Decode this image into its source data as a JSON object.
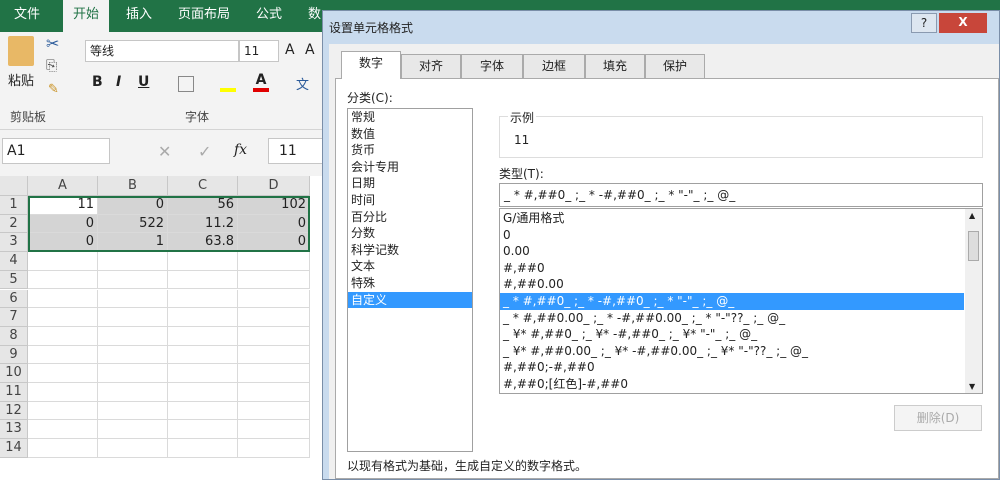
{
  "ribbon_tabs": [
    "文件",
    "开始",
    "插入",
    "页面布局",
    "公式",
    "数"
  ],
  "ribbon": {
    "paste": "粘贴",
    "clipboard_group": "剪贴板",
    "font_name": "等线",
    "font_size": "11",
    "font_group": "字体",
    "bold": "B",
    "italic": "I",
    "underline": "U",
    "phonetic": "文"
  },
  "formula_bar": {
    "name_box": "A1",
    "fx": "fx",
    "value": "11"
  },
  "sheet": {
    "columns": [
      "A",
      "B",
      "C",
      "D"
    ],
    "rows": [
      "1",
      "2",
      "3",
      "4",
      "5",
      "6",
      "7",
      "8",
      "9",
      "10",
      "11",
      "12",
      "13",
      "14"
    ],
    "cells": [
      [
        "11",
        "0",
        "56",
        "102"
      ],
      [
        "0",
        "522",
        "11.2",
        "0"
      ],
      [
        "0",
        "1",
        "63.8",
        "0"
      ]
    ]
  },
  "dialog": {
    "title": "设置单元格格式",
    "help": "?",
    "close": "X",
    "tabs": [
      "数字",
      "对齐",
      "字体",
      "边框",
      "填充",
      "保护"
    ],
    "category_label": "分类(C):",
    "categories": [
      "常规",
      "数值",
      "货币",
      "会计专用",
      "日期",
      "时间",
      "百分比",
      "分数",
      "科学记数",
      "文本",
      "特殊",
      "自定义"
    ],
    "selected_category": "自定义",
    "sample_label": "示例",
    "sample_value": "11",
    "type_label": "类型(T):",
    "type_value": "_ * #,##0_ ;_ * -#,##0_ ;_ * \"-\"_ ;_ @_",
    "formats": [
      "G/通用格式",
      "0",
      "0.00",
      "#,##0",
      "#,##0.00",
      "_ * #,##0_ ;_ * -#,##0_ ;_ * \"-\"_ ;_ @_",
      "_ * #,##0.00_ ;_ * -#,##0.00_ ;_ * \"-\"??_ ;_ @_",
      "_ ¥* #,##0_ ;_ ¥* -#,##0_ ;_ ¥* \"-\"_ ;_ @_",
      "_ ¥* #,##0.00_ ;_ ¥* -#,##0.00_ ;_ ¥* \"-\"??_ ;_ @_",
      "#,##0;-#,##0",
      "#,##0;[红色]-#,##0"
    ],
    "delete_button": "删除(D)",
    "description": "以现有格式为基础，生成自定义的数字格式。"
  }
}
